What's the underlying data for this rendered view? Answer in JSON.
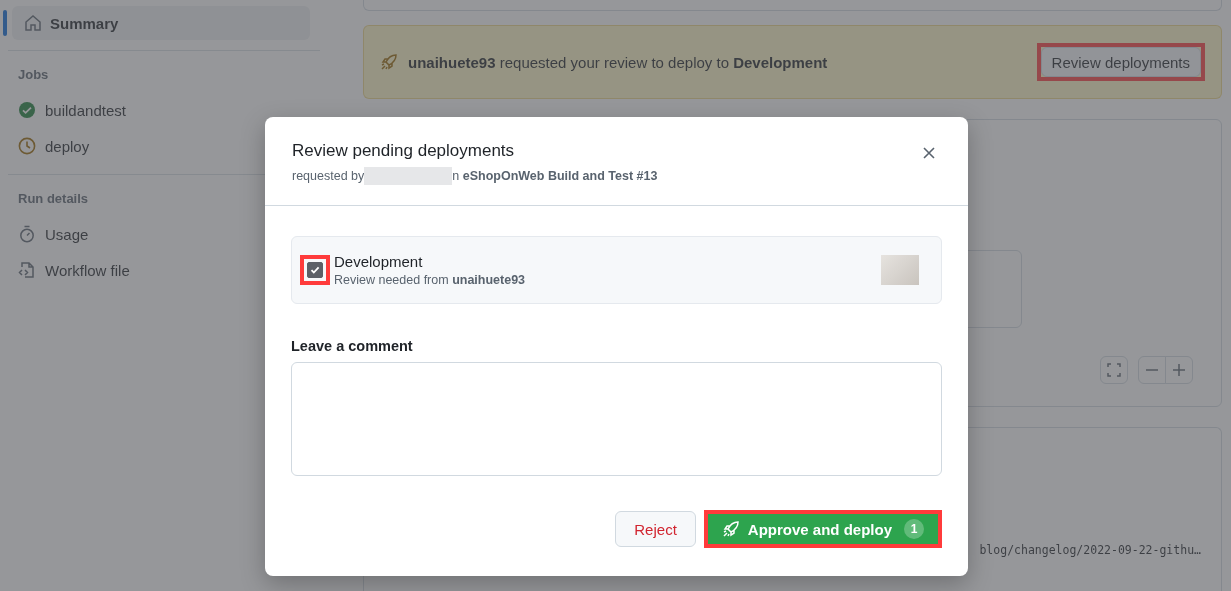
{
  "sidebar": {
    "summary": {
      "label": "Summary",
      "selected": true
    },
    "sections": [
      {
        "title": "Jobs",
        "items": [
          {
            "label": "buildandtest",
            "kind": "success"
          },
          {
            "label": "deploy",
            "kind": "waiting"
          }
        ]
      },
      {
        "title": "Run details",
        "items": [
          {
            "label": "Usage",
            "kind": "usage"
          },
          {
            "label": "Workflow file",
            "kind": "file"
          }
        ]
      }
    ]
  },
  "banner": {
    "message": "**unaihuete93** requested your review to deploy to **Development**",
    "button": "Review deployments",
    "highlighted": true
  },
  "log_card": {
    "line": "blog/changelog/2022-09-22-githu…"
  },
  "dialog": {
    "title": "Review pending deployments",
    "subtitle_prefix": "requested by",
    "subtitle_suffix": "n **eShopOnWeb Build and Test #13**",
    "environments": [
      {
        "name": "Development",
        "detail": "Review needed from **unaihuete93**",
        "checked": true,
        "highlighted": true
      }
    ],
    "comment_label": "Leave a comment",
    "reject": "Reject",
    "approve": "Approve and deploy",
    "approve_count": "1",
    "approve_highlighted": true
  }
}
